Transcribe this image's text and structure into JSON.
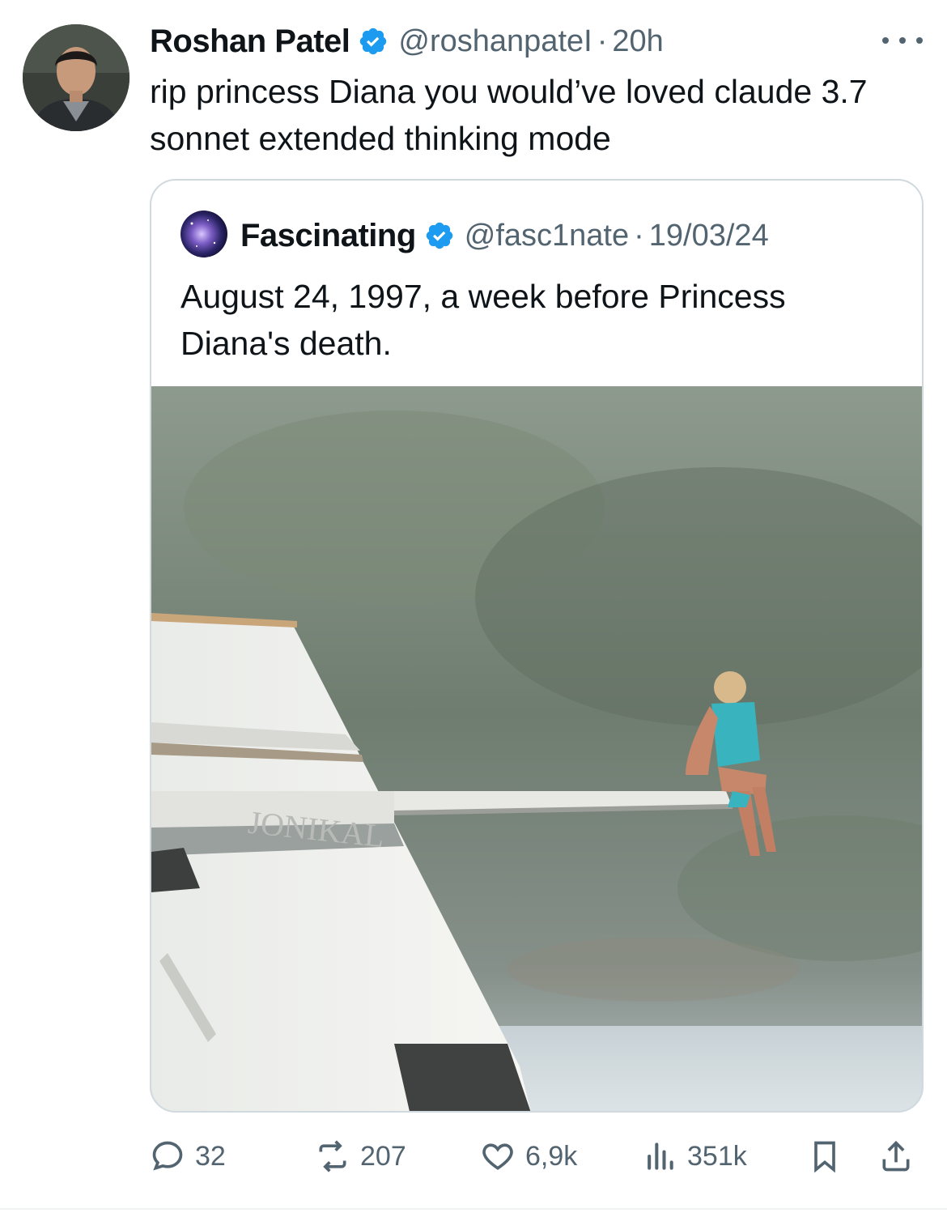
{
  "tweet": {
    "author_name": "Roshan Patel",
    "handle": "@roshanpateI",
    "separator": "·",
    "time": "20h",
    "text": "rip princess Diana you would’ve loved claude 3.7 sonnet extended thinking mode"
  },
  "quoted_tweet": {
    "author_name": "Fascinating",
    "handle": "@fasc1nate",
    "separator": "·",
    "date": "19/03/24",
    "text": "August 24, 1997, a week before Princess Diana's death."
  },
  "actions": {
    "replies": "32",
    "reposts": "207",
    "likes": "6,9k",
    "views": "351k"
  },
  "colors": {
    "verified": "#1d9bf0",
    "muted_text": "#536471",
    "border": "#cfd9de"
  },
  "icons": [
    "verified-badge-icon",
    "more-icon",
    "reply-icon",
    "repost-icon",
    "like-icon",
    "views-icon",
    "bookmark-icon",
    "share-icon"
  ]
}
